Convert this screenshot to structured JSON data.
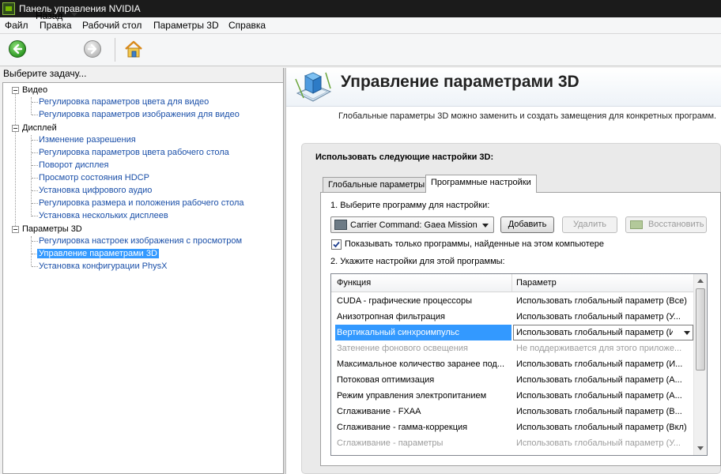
{
  "window": {
    "title": "Панель управления NVIDIA"
  },
  "menu": [
    "Файл",
    "Правка",
    "Рабочий стол",
    "Параметры 3D",
    "Справка"
  ],
  "toolbar": {
    "back_label": "Назад"
  },
  "left_panel": {
    "header": "Выберите задачу...",
    "categories": [
      {
        "label": "Видео",
        "items": [
          "Регулировка параметров цвета для видео",
          "Регулировка параметров изображения для видео"
        ]
      },
      {
        "label": "Дисплей",
        "items": [
          "Изменение разрешения",
          "Регулировка параметров цвета рабочего стола",
          "Поворот дисплея",
          "Просмотр состояния HDCP",
          "Установка цифрового аудио",
          "Регулировка размера и положения рабочего стола",
          "Установка нескольких дисплеев"
        ]
      },
      {
        "label": "Параметры 3D",
        "items": [
          "Регулировка настроек изображения с просмотром",
          "Управление параметрами 3D",
          "Установка конфигурации PhysX"
        ]
      }
    ],
    "selected_item": "Управление параметрами 3D"
  },
  "main": {
    "title": "Управление параметрами 3D",
    "description": "Глобальные параметры 3D можно заменить и создать замещения для конкретных программ.",
    "settings_title": "Использовать следующие настройки 3D:",
    "tabs": [
      {
        "label": "Глобальные параметры",
        "active": false
      },
      {
        "label": "Программные настройки",
        "active": true
      }
    ],
    "step1_label": "1. Выберите программу для настройки:",
    "program_select": {
      "value": "Carrier Command: Gaea Mission"
    },
    "buttons": {
      "add": "Добавить",
      "delete": "Удалить",
      "restore": "Восстановить"
    },
    "show_only_checkbox": {
      "label": "Показывать только программы, найденные на этом компьютере",
      "checked": true
    },
    "step2_label": "2. Укажите настройки для этой программы:",
    "table": {
      "columns": [
        "Функция",
        "Параметр"
      ],
      "rows": [
        {
          "feature": "CUDA - графические процессоры",
          "value": "Использовать глобальный параметр (Все)",
          "state": "normal"
        },
        {
          "feature": "Анизотропная фильтрация",
          "value": "Использовать глобальный параметр (У...",
          "state": "normal"
        },
        {
          "feature": "Вертикальный синхроимпульс",
          "value": "Использовать глобальный параметр (Ис",
          "state": "selected"
        },
        {
          "feature": "Затенение фонового освещения",
          "value": "Не поддерживается для этого приложе...",
          "state": "disabled"
        },
        {
          "feature": "Максимальное количество заранее под...",
          "value": "Использовать глобальный параметр (И...",
          "state": "normal"
        },
        {
          "feature": "Потоковая оптимизация",
          "value": "Использовать глобальный параметр (А...",
          "state": "normal"
        },
        {
          "feature": "Режим управления электропитанием",
          "value": "Использовать глобальный параметр (А...",
          "state": "normal"
        },
        {
          "feature": "Сглаживание - FXAA",
          "value": "Использовать глобальный параметр (В...",
          "state": "normal"
        },
        {
          "feature": "Сглаживание - гамма-коррекция",
          "value": "Использовать глобальный параметр (Вкл)",
          "state": "normal"
        },
        {
          "feature": "Сглаживание - параметры",
          "value": "Использовать глобальный параметр (У...",
          "state": "disabled"
        }
      ]
    }
  },
  "colors": {
    "accent": "#3399ff",
    "link": "#1a4fa8",
    "nvidia_green": "#76b900",
    "disabled_text": "#9c9c9c"
  },
  "icons": [
    "nvidia-app-icon",
    "back-arrow-icon",
    "forward-arrow-icon",
    "home-icon",
    "3d-settings-icon",
    "nvidia-logo-icon",
    "checkmark-icon"
  ]
}
